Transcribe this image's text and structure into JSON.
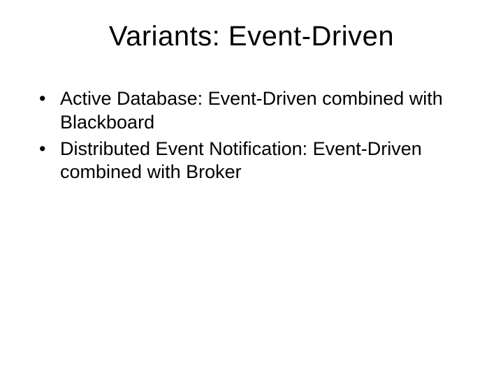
{
  "slide": {
    "title": "Variants:  Event-Driven",
    "bullets": [
      "Active Database: Event-Driven combined with Blackboard",
      "Distributed Event Notification: Event-Driven combined with  Broker"
    ]
  }
}
